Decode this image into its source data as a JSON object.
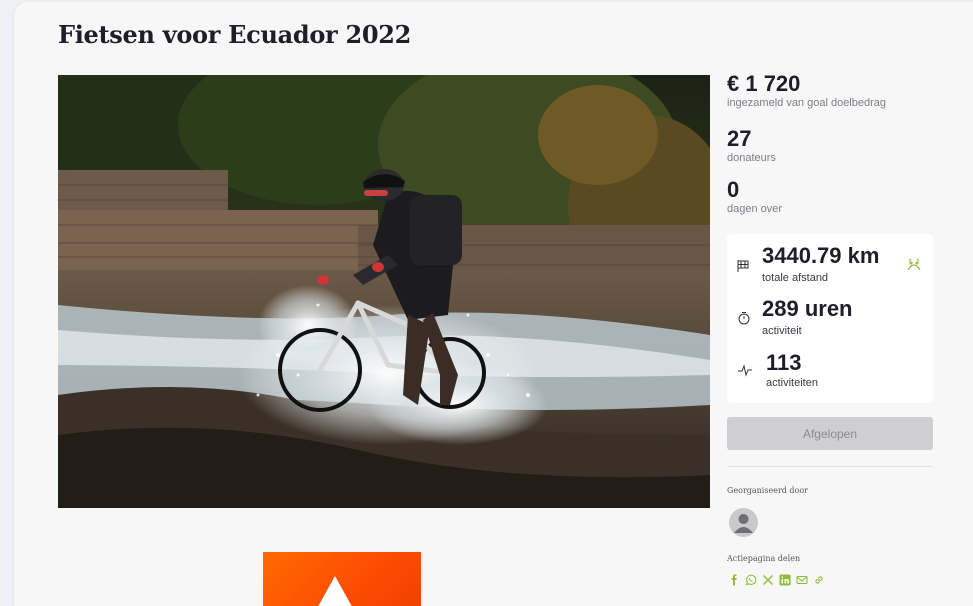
{
  "page": {
    "title": "Fietsen voor Ecuador 2022"
  },
  "stats": {
    "raised_amount": "€ 1 720",
    "raised_label": "ingezameld van goal doelbedrag",
    "donors_count": "27",
    "donors_label": "donateurs",
    "days_left": "0",
    "days_label": "dagen over"
  },
  "activity": {
    "distance_value": "3440.79 km",
    "distance_label": "totale afstand",
    "duration_value": "289 uren",
    "duration_label": "activiteit",
    "activities_value": "113",
    "activities_label": "activiteiten"
  },
  "status_button": {
    "label": "Afgelopen"
  },
  "organizer": {
    "label": "Georganiseerd door"
  },
  "share": {
    "label": "Actiepagina delen",
    "icons": [
      "facebook-icon",
      "whatsapp-icon",
      "x-icon",
      "linkedin-icon",
      "mail-icon",
      "link-icon"
    ]
  },
  "colors": {
    "accent_green": "#8fbc3a",
    "strava_orange": "#fc4c02",
    "disabled_button": "#cfcfd1"
  }
}
